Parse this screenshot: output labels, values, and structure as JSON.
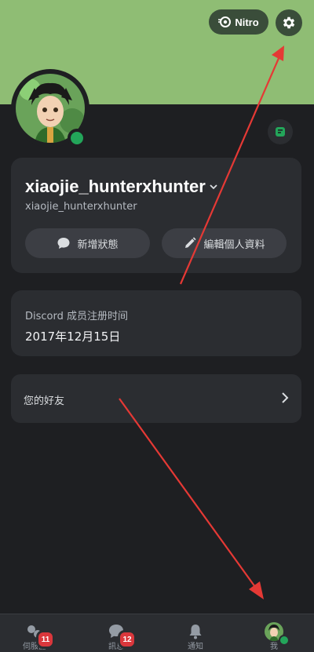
{
  "header": {
    "nitro_label": "Nitro"
  },
  "profile": {
    "display_name": "xiaojie_hunterxhunter",
    "username": "xiaojie_hunterxhunter",
    "status_button": "新增狀態",
    "edit_button": "編輯個人資料"
  },
  "member": {
    "label": "Discord 成员注册时间",
    "date": "2017年12月15日"
  },
  "friends": {
    "label": "您的好友"
  },
  "nav": {
    "items": [
      {
        "label": "伺服器",
        "badge": "11"
      },
      {
        "label": "訊息",
        "badge": "12"
      },
      {
        "label": "通知"
      },
      {
        "label": "我"
      }
    ]
  },
  "colors": {
    "banner": "#8fbd74",
    "background": "#1e1f22",
    "card": "#2b2d31",
    "online": "#23a55a",
    "badge": "#da373c",
    "annotation_arrow": "#e53935"
  }
}
